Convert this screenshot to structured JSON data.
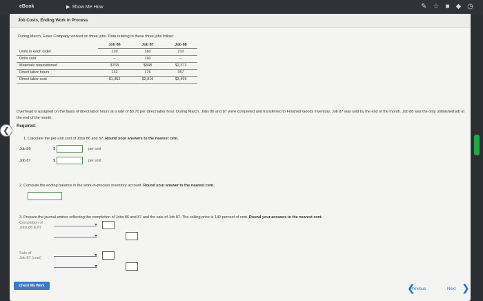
{
  "topbar": {
    "ebook": "eBook",
    "show_me_how": "Show Me How"
  },
  "title": "Job Costs, Ending Work in Process",
  "intro": "During March, Estes Company worked on three jobs. Data relating to these three jobs follow:",
  "table": {
    "headers": [
      "Job 86",
      "Job 87",
      "Job 88"
    ],
    "rows": [
      {
        "label": "Units in each order",
        "v": [
          "120",
          "160",
          "210"
        ]
      },
      {
        "label": "Units sold",
        "v": [
          "--",
          "160",
          "--"
        ]
      },
      {
        "label": "Materials requisitioned",
        "v": [
          "$768",
          "$848",
          "$2,373"
        ]
      },
      {
        "label": "Direct labor hours",
        "v": [
          "132",
          "176",
          "357"
        ]
      },
      {
        "label": "Direct labor cost",
        "v": [
          "$1,452",
          "$2,816",
          "$3,499"
        ]
      }
    ]
  },
  "overhead_text": "Overhead is assigned on the basis of direct labor hours at a rate of $9.70 per direct labor hour. During March, Jobs 86 and 87 were completed and transferred to Finished Goods Inventory. Job 87 was sold by the end of the month. Job 88 was the only unfinished job at the end of the month.",
  "required_label": "Required:",
  "q1": {
    "text": "1. Calculate the per-unit cost of Jobs 86 and 87.",
    "bold": "Round your answers to the nearest cent.",
    "rows": [
      {
        "label": "Job 86",
        "dollar": "$",
        "unit": "per unit"
      },
      {
        "label": "Job 87",
        "dollar": "$",
        "unit": "per unit"
      }
    ]
  },
  "q2": {
    "text": "2. Compute the ending balance in the work-in-process inventory account.",
    "bold": "Round your answer to the nearest cent."
  },
  "q3": {
    "text": "3. Prepare the journal entries reflecting the completion of Jobs 86 and 87 and the sale of Job 87. The selling price is 140 percent of cost.",
    "bold": "Round your answers to the nearest cent.",
    "entry1_a": "Completion of",
    "entry1_b": "Jobs 86 & 87",
    "entry2_a": "Sale of",
    "entry2_b": "Job 87 (cost)"
  },
  "check_button": "Check My Work",
  "nav": {
    "previous": "Previous",
    "next": "Next",
    "prev_glyph": "❮",
    "next_glyph": "❯",
    "side_left_glyph": "❮"
  }
}
